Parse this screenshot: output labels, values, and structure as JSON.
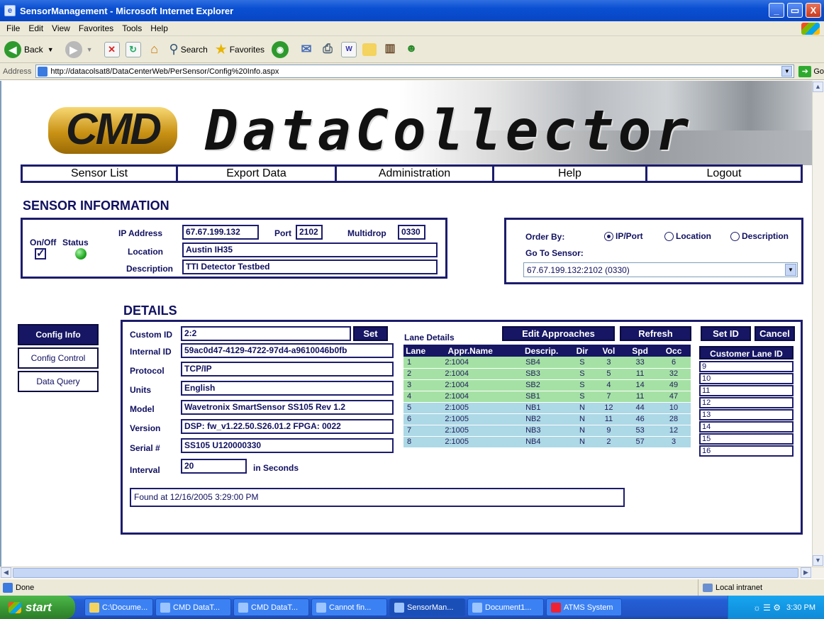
{
  "window": {
    "title": "SensorManagement - Microsoft Internet Explorer",
    "minimize": "_",
    "maximize": "▭",
    "close": "X"
  },
  "menu": [
    "File",
    "Edit",
    "View",
    "Favorites",
    "Tools",
    "Help"
  ],
  "toolbar": {
    "back": "Back",
    "search": "Search",
    "favorites": "Favorites"
  },
  "address": {
    "label": "Address",
    "url": "http://datacolsat8/DataCenterWeb/PerSensor/Config%20Info.aspx",
    "go": "Go"
  },
  "banner": {
    "logo": "CMD",
    "title": "DataCollector"
  },
  "nav": [
    "Sensor List",
    "Export Data",
    "Administration",
    "Help",
    "Logout"
  ],
  "sensor_info": {
    "heading": "SENSOR INFORMATION",
    "onoff_label": "On/Off",
    "status_label": "Status",
    "ip_label": "IP Address",
    "ip": "67.67.199.132",
    "port_label": "Port",
    "port": "2102",
    "multidrop_label": "Multidrop",
    "multidrop": "0330",
    "location_label": "Location",
    "location": "Austin IH35",
    "description_label": "Description",
    "description": "TTI Detector Testbed",
    "enabled": true,
    "status_color": "#22aa22"
  },
  "order": {
    "label": "Order By:",
    "options": [
      "IP/Port",
      "Location",
      "Description"
    ],
    "selected": "IP/Port",
    "goto_label": "Go To Sensor:",
    "goto_value": "67.67.199.132:2102 (0330)"
  },
  "details": {
    "heading": "DETAILS",
    "tabs": [
      "Config Info",
      "Config Control",
      "Data Query"
    ],
    "active_tab": "Config Info",
    "custom_id_label": "Custom ID",
    "custom_id": "2:2",
    "set_label": "Set",
    "internal_id_label": "Internal ID",
    "internal_id": "59ac0d47-4129-4722-97d4-a9610046b0fb",
    "protocol_label": "Protocol",
    "protocol": "TCP/IP",
    "units_label": "Units",
    "units": "English",
    "model_label": "Model",
    "model": "Wavetronix SmartSensor SS105 Rev 1.2",
    "version_label": "Version",
    "version": "DSP: fw_v1.22.50.S26.01.2 FPGA: 0022",
    "serial_label": "Serial #",
    "serial": "SS105 U120000330",
    "interval_label": "Interval",
    "interval": "20",
    "interval_suffix": "in Seconds",
    "found": "Found at 12/16/2005 3:29:00 PM"
  },
  "lanes": {
    "title": "Lane Details",
    "edit_label": "Edit Approaches",
    "refresh_label": "Refresh",
    "setid_label": "Set ID",
    "cancel_label": "Cancel",
    "customer_lane_header": "Customer Lane ID",
    "columns": [
      "Lane",
      "Appr.Name",
      "Descrip.",
      "Dir",
      "Vol",
      "Spd",
      "Occ"
    ],
    "rows": [
      [
        "1",
        "2:1004",
        "SB4",
        "S",
        "3",
        "33",
        "6"
      ],
      [
        "2",
        "2:1004",
        "SB3",
        "S",
        "5",
        "11",
        "32"
      ],
      [
        "3",
        "2:1004",
        "SB2",
        "S",
        "4",
        "14",
        "49"
      ],
      [
        "4",
        "2:1004",
        "SB1",
        "S",
        "7",
        "11",
        "47"
      ],
      [
        "5",
        "2:1005",
        "NB1",
        "N",
        "12",
        "44",
        "10"
      ],
      [
        "6",
        "2:1005",
        "NB2",
        "N",
        "11",
        "46",
        "28"
      ],
      [
        "7",
        "2:1005",
        "NB3",
        "N",
        "9",
        "53",
        "12"
      ],
      [
        "8",
        "2:1005",
        "NB4",
        "N",
        "2",
        "57",
        "3"
      ]
    ],
    "customer_ids": [
      "9",
      "10",
      "11",
      "12",
      "13",
      "14",
      "15",
      "16"
    ]
  },
  "status": {
    "text": "Done",
    "zone": "Local intranet"
  },
  "taskbar": {
    "start": "start",
    "tasks": [
      "C:\\Docume...",
      "CMD DataT...",
      "CMD DataT...",
      "Cannot fin...",
      "SensorMan...",
      "Document1...",
      "ATMS System"
    ],
    "active_task": "SensorMan...",
    "clock": "3:30 PM"
  }
}
